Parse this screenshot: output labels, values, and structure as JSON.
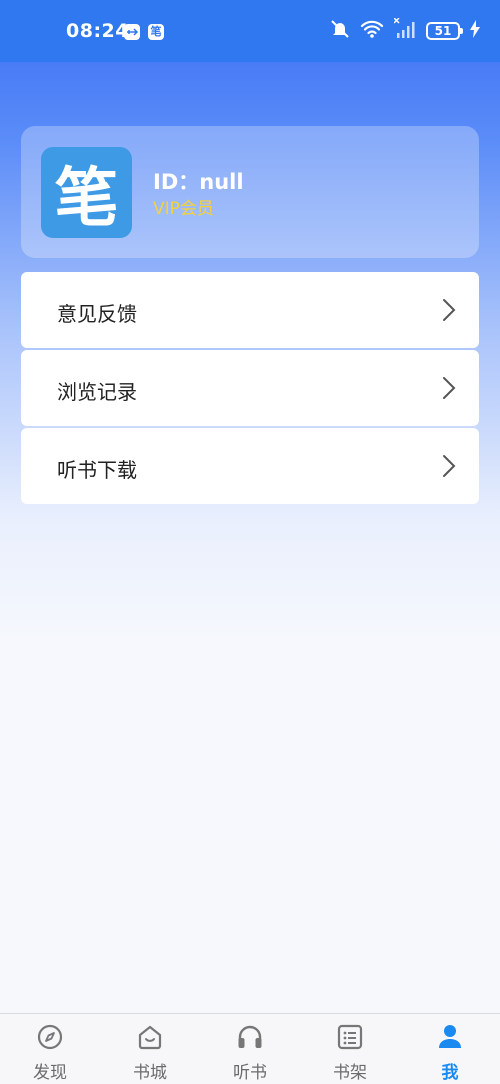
{
  "status_bar": {
    "time": "08:24",
    "badge_app": "笔",
    "battery": "51",
    "icons": [
      "usb-icon",
      "app-notification-icon",
      "mute-bell-icon",
      "wifi-icon",
      "signal-icon",
      "battery-icon",
      "charging-icon"
    ]
  },
  "profile": {
    "avatar_char": "笔",
    "id_text": "ID：null",
    "membership": "VIP会员",
    "membership_color": "#f4d23c"
  },
  "menu": {
    "items": [
      {
        "label": "意见反馈",
        "icon": "chevron-right-icon"
      },
      {
        "label": "浏览记录",
        "icon": "chevron-right-icon"
      },
      {
        "label": "听书下载",
        "icon": "chevron-right-icon"
      }
    ]
  },
  "bottom_nav": {
    "items": [
      {
        "label": "发现",
        "icon": "compass-icon"
      },
      {
        "label": "书城",
        "icon": "bookstore-icon"
      },
      {
        "label": "听书",
        "icon": "headphones-icon"
      },
      {
        "label": "书架",
        "icon": "bookshelf-icon"
      },
      {
        "label": "我",
        "icon": "profile-icon"
      }
    ],
    "active": "我",
    "active_color": "#1a8af0"
  },
  "colors": {
    "status_bar": "#2f78f0",
    "avatar_bg": "#3f9ae6"
  }
}
